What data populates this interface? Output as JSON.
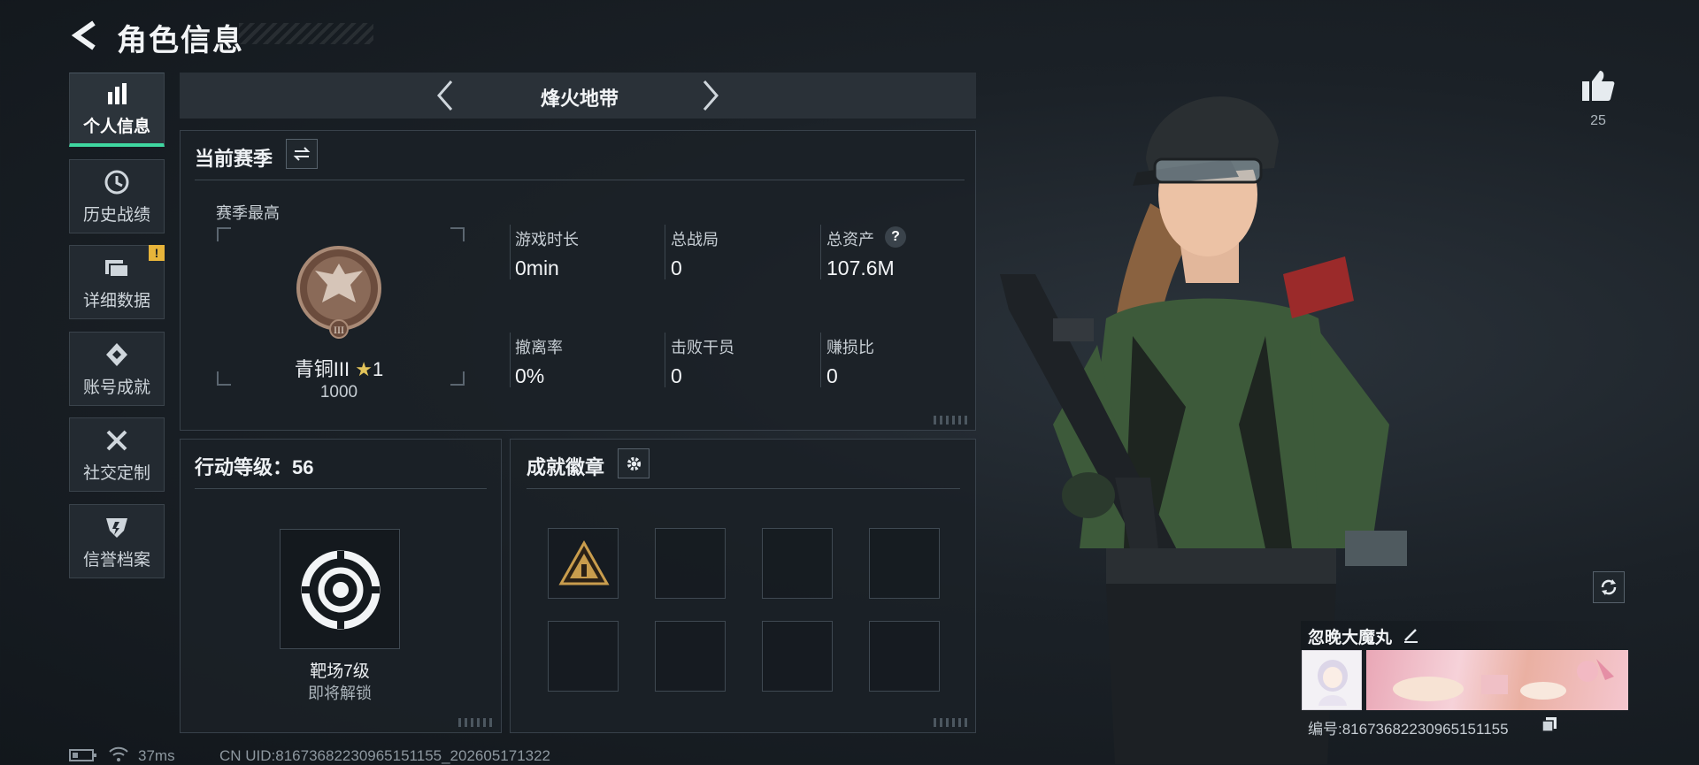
{
  "header": {
    "title": "角色信息"
  },
  "sidebar": {
    "items": [
      {
        "label": "个人信息",
        "icon": "bar-chart-icon",
        "active": true
      },
      {
        "label": "历史战绩",
        "icon": "clock-icon"
      },
      {
        "label": "详细数据",
        "icon": "folder-icon",
        "badge": "!"
      },
      {
        "label": "账号成就",
        "icon": "achievement-icon"
      },
      {
        "label": "社交定制",
        "icon": "tools-icon"
      },
      {
        "label": "信誉档案",
        "icon": "shield-icon"
      }
    ]
  },
  "mode": {
    "name": "烽火地带"
  },
  "season": {
    "title": "当前赛季",
    "best_label": "赛季最高",
    "rank_name": "青铜III",
    "rank_stars": "1",
    "rank_points": "1000",
    "stats": [
      {
        "label": "游戏时长",
        "value": "0min"
      },
      {
        "label": "总战局",
        "value": "0"
      },
      {
        "label": "总资产",
        "value": "107.6M",
        "help": "?"
      },
      {
        "label": "撤离率",
        "value": "0%"
      },
      {
        "label": "击败干员",
        "value": "0"
      },
      {
        "label": "赚损比",
        "value": "0"
      }
    ]
  },
  "action_level": {
    "title": "行动等级：56",
    "unlock_name": "靶场7级",
    "unlock_status": "即将解锁"
  },
  "badges": {
    "title": "成就徽章"
  },
  "like": {
    "count": "25"
  },
  "profile": {
    "name": "忽晚大魔丸",
    "id_text": "编号:81673682230965151155"
  },
  "footer": {
    "ping": "37ms",
    "uid": "CN UID:81673682230965151155_202605171322"
  },
  "colors": {
    "accent": "#3fd7a0",
    "warning": "#e7b43a"
  }
}
